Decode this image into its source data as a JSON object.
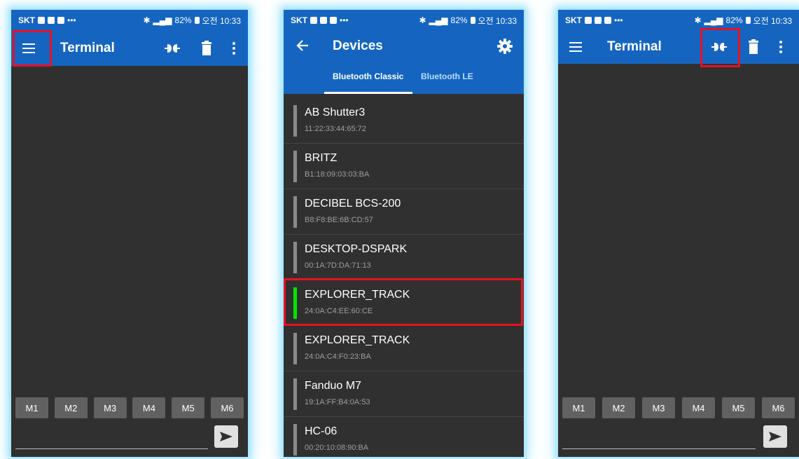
{
  "status": {
    "carrier": "SKT",
    "battery": "82%",
    "time": "오전 10:33"
  },
  "terminal": {
    "title": "Terminal",
    "macros": [
      "M1",
      "M2",
      "M3",
      "M4",
      "M5",
      "M6"
    ]
  },
  "devices": {
    "title": "Devices",
    "tabs": [
      "Bluetooth Classic",
      "Bluetooth LE"
    ],
    "selected_tab": "Bluetooth Classic",
    "items": [
      {
        "name": "AB Shutter3",
        "address": "11:22:33:44:65:72"
      },
      {
        "name": "BRITZ",
        "address": "B1:18:09:03:03:BA"
      },
      {
        "name": "DECIBEL BCS-200",
        "address": "B8:F8:BE:6B:CD:57"
      },
      {
        "name": "DESKTOP-DSPARK",
        "address": "00:1A:7D:DA:71:13"
      },
      {
        "name": "EXPLORER_TRACK",
        "address": "24:0A:C4:EE:60:CE"
      },
      {
        "name": "EXPLORER_TRACK",
        "address": "24:0A:C4:F0:23:BA"
      },
      {
        "name": "Fanduo M7",
        "address": "19:1A:FF:B4:0A:53"
      },
      {
        "name": "HC-06",
        "address": "00:20:10:08:90:BA"
      }
    ],
    "highlighted_index": 4
  },
  "icons": {
    "menu": "hamburger-menu-icon",
    "connect": "connect-plug-icon",
    "delete": "trash-icon",
    "overflow": "more-vert-icon",
    "back": "back-arrow-icon",
    "settings": "gear-icon",
    "send": "send-icon"
  },
  "colors": {
    "appbar": "#1565c0",
    "background": "#303030",
    "macro_button": "#616161",
    "highlight_box": "#e81123",
    "active_indicator": "#00e600",
    "glow": "#9fe3ff"
  }
}
